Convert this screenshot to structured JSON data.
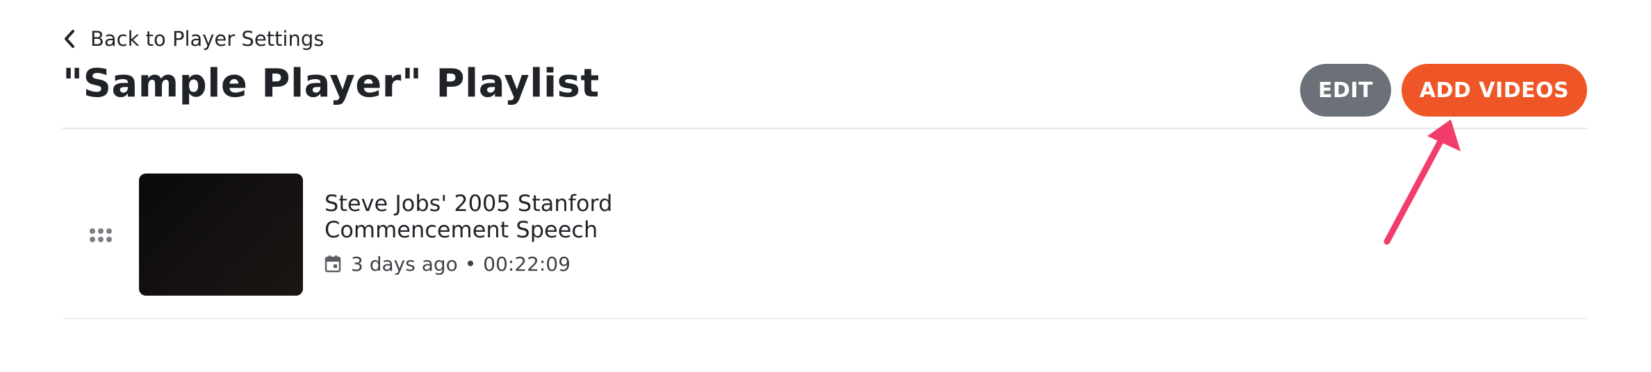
{
  "nav": {
    "back_label": "Back to Player Settings",
    "back_icon": "chevron-left-icon"
  },
  "header": {
    "title": "\"Sample Player\" Playlist",
    "edit_label": "EDIT",
    "add_videos_label": "ADD VIDEOS"
  },
  "playlist": {
    "items": [
      {
        "title_line1": "Steve Jobs' 2005 Stanford",
        "title_line2": "Commencement Speech",
        "date": "3 days ago",
        "separator": "•",
        "duration": "00:22:09",
        "date_icon": "calendar-icon",
        "drag_icon": "drag-handle-icon"
      }
    ]
  },
  "colors": {
    "accent": "#ee5627",
    "secondary_button": "#6b7079",
    "text": "#1f2328",
    "annotation": "#f23d6a"
  }
}
